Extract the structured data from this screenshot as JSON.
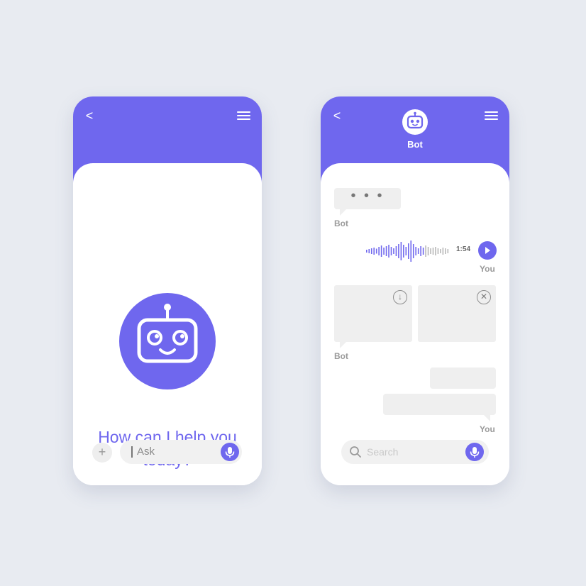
{
  "left_phone": {
    "back_glyph": "<",
    "help_text": "How can I help you today?",
    "plus_glyph": "+",
    "ask_placeholder": "Ask"
  },
  "right_phone": {
    "back_glyph": "<",
    "bot_name": "Bot",
    "typing_indicator": "• • •",
    "sender_bot": "Bot",
    "sender_you": "You",
    "voice_duration": "1:54",
    "search_placeholder": "Search",
    "card_1_icon": "download-circle-icon",
    "card_2_icon": "close-circle-icon"
  },
  "colors": {
    "accent": "#6f67ee",
    "background": "#e8ebf1",
    "bubble": "#efefef"
  }
}
